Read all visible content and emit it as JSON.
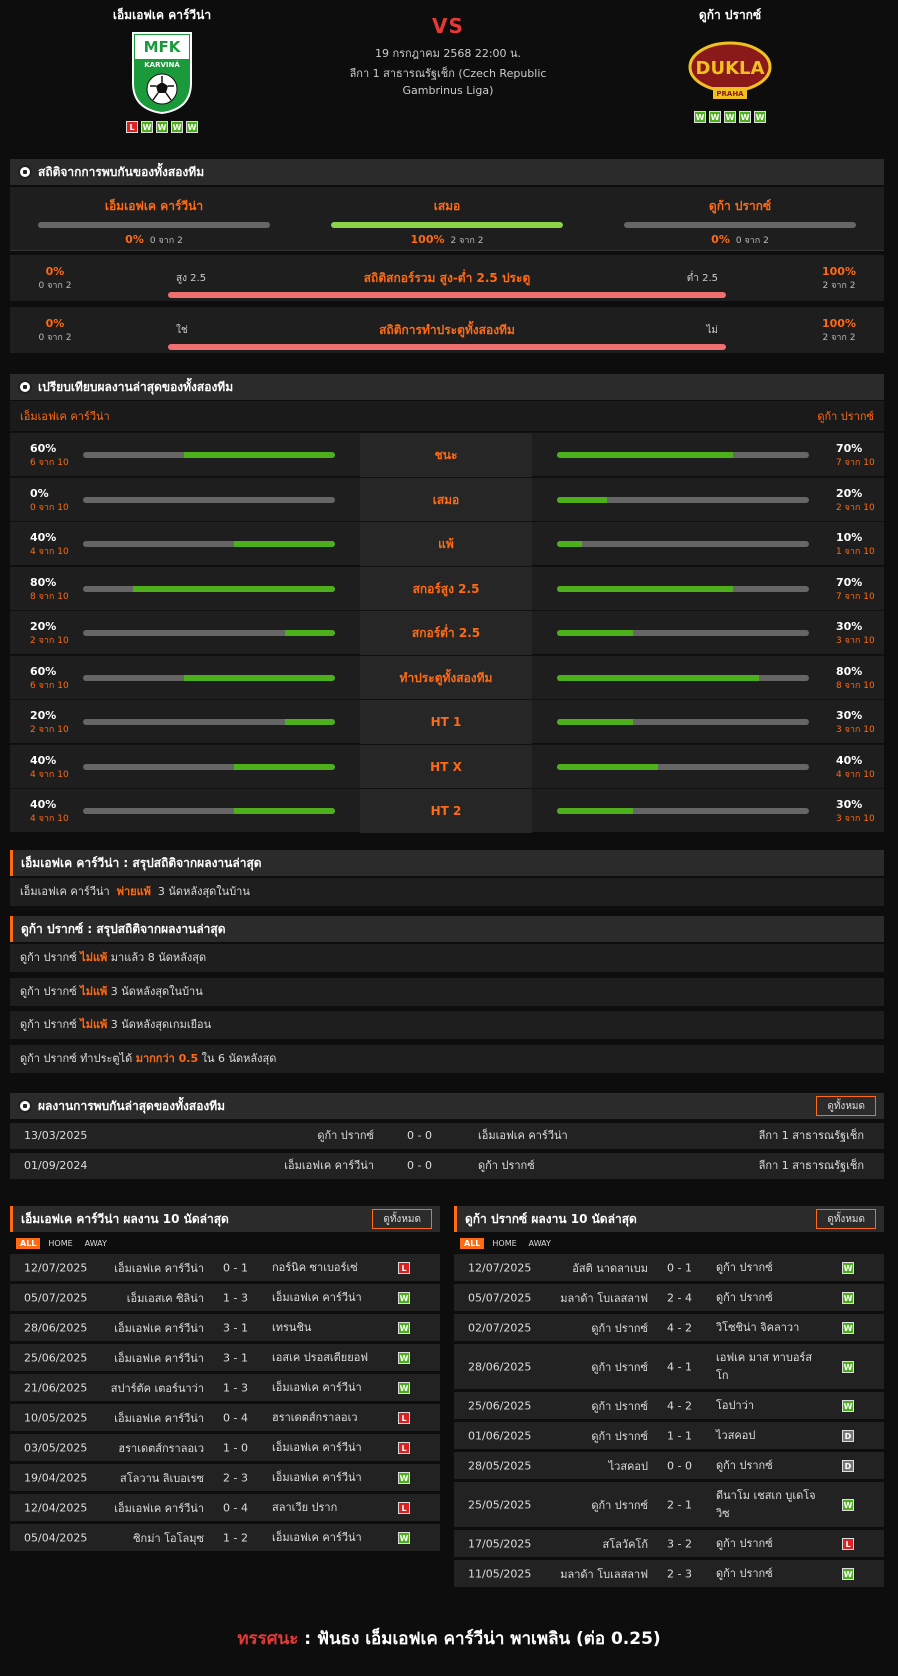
{
  "header": {
    "home_name": "เอ็มเอฟเค คาร์วีน่า",
    "away_name": "ดูก้า ปรากซ์",
    "vs": "VS",
    "date": "19 กรกฎาคม 2568 22:00 น.",
    "league": "ลีกา 1 สาธารณรัฐเช็ก (Czech Republic Gambrinus Liga)",
    "home_logo_text": "MFK",
    "home_logo_sub": "KARVINÁ",
    "away_logo_text": "DUKLA",
    "away_logo_sub": "PRAHA",
    "home_form": [
      "L",
      "W",
      "W",
      "W",
      "W"
    ],
    "away_form": [
      "W",
      "W",
      "W",
      "W",
      "W"
    ]
  },
  "h2h_stats": {
    "title": "สถิติจากการพบกันของทั้งสองทีม",
    "cols": [
      {
        "label": "เอ็มเอฟเค คาร์วีน่า",
        "pct": "0%",
        "of": "0 จาก 2",
        "fill": 0
      },
      {
        "label": "เสมอ",
        "pct": "100%",
        "of": "2 จาก 2",
        "fill": 1
      },
      {
        "label": "ดูก้า ปรากซ์",
        "pct": "0%",
        "of": "0 จาก 2",
        "fill": 0
      }
    ],
    "ou": {
      "title": "สถิติสกอร์รวม สูง-ต่ำ 2.5 ประตู",
      "left_label": "สูง 2.5",
      "right_label": "ต่ำ 2.5",
      "left_pct": "0%",
      "left_of": "0 จาก 2",
      "right_pct": "100%",
      "right_of": "2 จาก 2"
    },
    "btts": {
      "title": "สถิติการทำประตูทั้งสองทีม",
      "left_label": "ใช่",
      "right_label": "ไม่",
      "left_pct": "0%",
      "left_of": "0 จาก 2",
      "right_pct": "100%",
      "right_of": "2 จาก 2"
    }
  },
  "compare": {
    "title": "เปรียบเทียบผลงานล่าสุดของทั้งสองทีม",
    "home": "เอ็มเอฟเค คาร์วีน่า",
    "away": "ดูก้า ปรากซ์",
    "rows": [
      {
        "label": "ชนะ",
        "l_pct": "60%",
        "l_of": "6 จาก 10",
        "l": 0.6,
        "r_pct": "70%",
        "r_of": "7 จาก 10",
        "r": 0.7
      },
      {
        "label": "เสมอ",
        "l_pct": "0%",
        "l_of": "0 จาก 10",
        "l": 0,
        "r_pct": "20%",
        "r_of": "2 จาก 10",
        "r": 0.2
      },
      {
        "label": "แพ้",
        "l_pct": "40%",
        "l_of": "4 จาก 10",
        "l": 0.4,
        "r_pct": "10%",
        "r_of": "1 จาก 10",
        "r": 0.1
      },
      {
        "label": "สกอร์สูง 2.5",
        "l_pct": "80%",
        "l_of": "8 จาก 10",
        "l": 0.8,
        "r_pct": "70%",
        "r_of": "7 จาก 10",
        "r": 0.7
      },
      {
        "label": "สกอร์ต่ำ 2.5",
        "l_pct": "20%",
        "l_of": "2 จาก 10",
        "l": 0.2,
        "r_pct": "30%",
        "r_of": "3 จาก 10",
        "r": 0.3
      },
      {
        "label": "ทำประตูทั้งสองทีม",
        "l_pct": "60%",
        "l_of": "6 จาก 10",
        "l": 0.6,
        "r_pct": "80%",
        "r_of": "8 จาก 10",
        "r": 0.8
      },
      {
        "label": "HT 1",
        "l_pct": "20%",
        "l_of": "2 จาก 10",
        "l": 0.2,
        "r_pct": "30%",
        "r_of": "3 จาก 10",
        "r": 0.3
      },
      {
        "label": "HT X",
        "l_pct": "40%",
        "l_of": "4 จาก 10",
        "l": 0.4,
        "r_pct": "40%",
        "r_of": "4 จาก 10",
        "r": 0.4
      },
      {
        "label": "HT 2",
        "l_pct": "40%",
        "l_of": "4 จาก 10",
        "l": 0.4,
        "r_pct": "30%",
        "r_of": "3 จาก 10",
        "r": 0.3
      }
    ]
  },
  "home_summary": {
    "title": "เอ็มเอฟเค คาร์วีน่า : สรุปสถิติจากผลงานล่าสุด",
    "rows": [
      {
        "pre": "เอ็มเอฟเค คาร์วีน่า",
        "hl": "พ่ายแพ้",
        "post": "3  นัดหลังสุดในบ้าน"
      }
    ]
  },
  "away_summary": {
    "title": "ดูก้า ปรากซ์ : สรุปสถิติจากผลงานล่าสุด",
    "rows": [
      {
        "pre": "ดูก้า ปรากซ์",
        "hl": "ไม่แพ้",
        "post": "มาแล้ว 8 นัดหลังสุด"
      },
      {
        "pre": "ดูก้า ปรากซ์",
        "hl": "ไม่แพ้",
        "post": "3  นัดหลังสุดในบ้าน"
      },
      {
        "pre": "ดูก้า ปรากซ์",
        "hl": "ไม่แพ้",
        "post": "3  นัดหลังสุดเกมเยือน"
      },
      {
        "pre": "ดูก้า ปรากซ์  ทำประตูได้",
        "hl": "มากกว่า  0.5",
        "post": "ใน 6 นัดหลังสุด"
      }
    ]
  },
  "last_h2h": {
    "title": "ผลงานการพบกันล่าสุดของทั้งสองทีม",
    "view_all": "ดูทั้งหมด",
    "rows": [
      {
        "date": "13/03/2025",
        "home": "ดูก้า ปรากซ์",
        "score": "0 - 0",
        "away": "เอ็มเอฟเค คาร์วีน่า",
        "league": "ลีกา 1 สาธารณรัฐเช็ก"
      },
      {
        "date": "01/09/2024",
        "home": "เอ็มเอฟเค คาร์วีน่า",
        "score": "0 - 0",
        "away": "ดูก้า ปรากซ์",
        "league": "ลีกา 1 สาธารณรัฐเช็ก"
      }
    ]
  },
  "home_last10": {
    "title": "เอ็มเอฟเค คาร์วีน่า ผลงาน 10 นัดล่าสุด",
    "view_all": "ดูทั้งหมด",
    "tabs": [
      "ALL",
      "HOME",
      "AWAY"
    ],
    "rows": [
      {
        "date": "12/07/2025",
        "home": "เอ็มเอฟเค คาร์วีน่า",
        "score": "0 - 1",
        "away": "กอร์นิค ซาเบอร์เซ่",
        "res": "L"
      },
      {
        "date": "05/07/2025",
        "home": "เอ็มเอสเค ซิลิน่า",
        "score": "1 - 3",
        "away": "เอ็มเอฟเค คาร์วีน่า",
        "res": "W"
      },
      {
        "date": "28/06/2025",
        "home": "เอ็มเอฟเค คาร์วีน่า",
        "score": "3 - 1",
        "away": "เทรนชิน",
        "res": "W"
      },
      {
        "date": "25/06/2025",
        "home": "เอ็มเอฟเค คาร์วีน่า",
        "score": "3 - 1",
        "away": "เอสเค ปรอสเตียยอฟ",
        "res": "W"
      },
      {
        "date": "21/06/2025",
        "home": "สปาร์ตัค เตอร์นาว่า",
        "score": "1 - 3",
        "away": "เอ็มเอฟเค คาร์วีน่า",
        "res": "W"
      },
      {
        "date": "10/05/2025",
        "home": "เอ็มเอฟเค คาร์วีน่า",
        "score": "0 - 4",
        "away": "ฮราเดตส์กราลอเว",
        "res": "L"
      },
      {
        "date": "03/05/2025",
        "home": "ฮราเดตส์กราลอเว",
        "score": "1 - 0",
        "away": "เอ็มเอฟเค คาร์วีน่า",
        "res": "L"
      },
      {
        "date": "19/04/2025",
        "home": "สโลวาน ลิเบอเรซ",
        "score": "2 - 3",
        "away": "เอ็มเอฟเค คาร์วีน่า",
        "res": "W"
      },
      {
        "date": "12/04/2025",
        "home": "เอ็มเอฟเค คาร์วีน่า",
        "score": "0 - 4",
        "away": "สลาเวีย ปราก",
        "res": "L"
      },
      {
        "date": "05/04/2025",
        "home": "ซิกม่า โอโลมุซ",
        "score": "1 - 2",
        "away": "เอ็มเอฟเค คาร์วีน่า",
        "res": "W"
      }
    ]
  },
  "away_last10": {
    "title": "ดูก้า ปรากซ์ ผลงาน 10 นัดล่าสุด",
    "view_all": "ดูทั้งหมด",
    "tabs": [
      "ALL",
      "HOME",
      "AWAY"
    ],
    "rows": [
      {
        "date": "12/07/2025",
        "home": "อัสติ นาดลาเบม",
        "score": "0 - 1",
        "away": "ดูก้า ปรากซ์",
        "res": "W"
      },
      {
        "date": "05/07/2025",
        "home": "มลาด้า โบเลสลาฟ",
        "score": "2 - 4",
        "away": "ดูก้า ปรากซ์",
        "res": "W"
      },
      {
        "date": "02/07/2025",
        "home": "ดูก้า ปรากซ์",
        "score": "4 - 2",
        "away": "วิโซชิน่า จิคลาวา",
        "res": "W"
      },
      {
        "date": "28/06/2025",
        "home": "ดูก้า ปรากซ์",
        "score": "4 - 1",
        "away": "เอฟเค มาส ทาบอร์ส โก",
        "res": "W"
      },
      {
        "date": "25/06/2025",
        "home": "ดูก้า ปรากซ์",
        "score": "4 - 2",
        "away": "โอปาว่า",
        "res": "W"
      },
      {
        "date": "01/06/2025",
        "home": "ดูก้า ปรากซ์",
        "score": "1 - 1",
        "away": "ไวสคอป",
        "res": "D"
      },
      {
        "date": "28/05/2025",
        "home": "ไวสคอป",
        "score": "0 - 0",
        "away": "ดูก้า ปรากซ์",
        "res": "D"
      },
      {
        "date": "25/05/2025",
        "home": "ดูก้า ปรากซ์",
        "score": "2 - 1",
        "away": "ดีนาโม เชสเก บูเดโจ วิซ",
        "res": "W"
      },
      {
        "date": "17/05/2025",
        "home": "สโลวัคโก้",
        "score": "3 - 2",
        "away": "ดูก้า ปรากซ์",
        "res": "L"
      },
      {
        "date": "11/05/2025",
        "home": "มลาด้า โบเลสลาฟ",
        "score": "2 - 3",
        "away": "ดูก้า ปรากซ์",
        "res": "W"
      }
    ]
  },
  "verdict": {
    "label": "ทรรศนะ",
    "sep": ":",
    "text": "ฟันธง เอ็มเอฟเค คาร์วีน่า พาเพลิน (ต่อ 0.25)"
  }
}
